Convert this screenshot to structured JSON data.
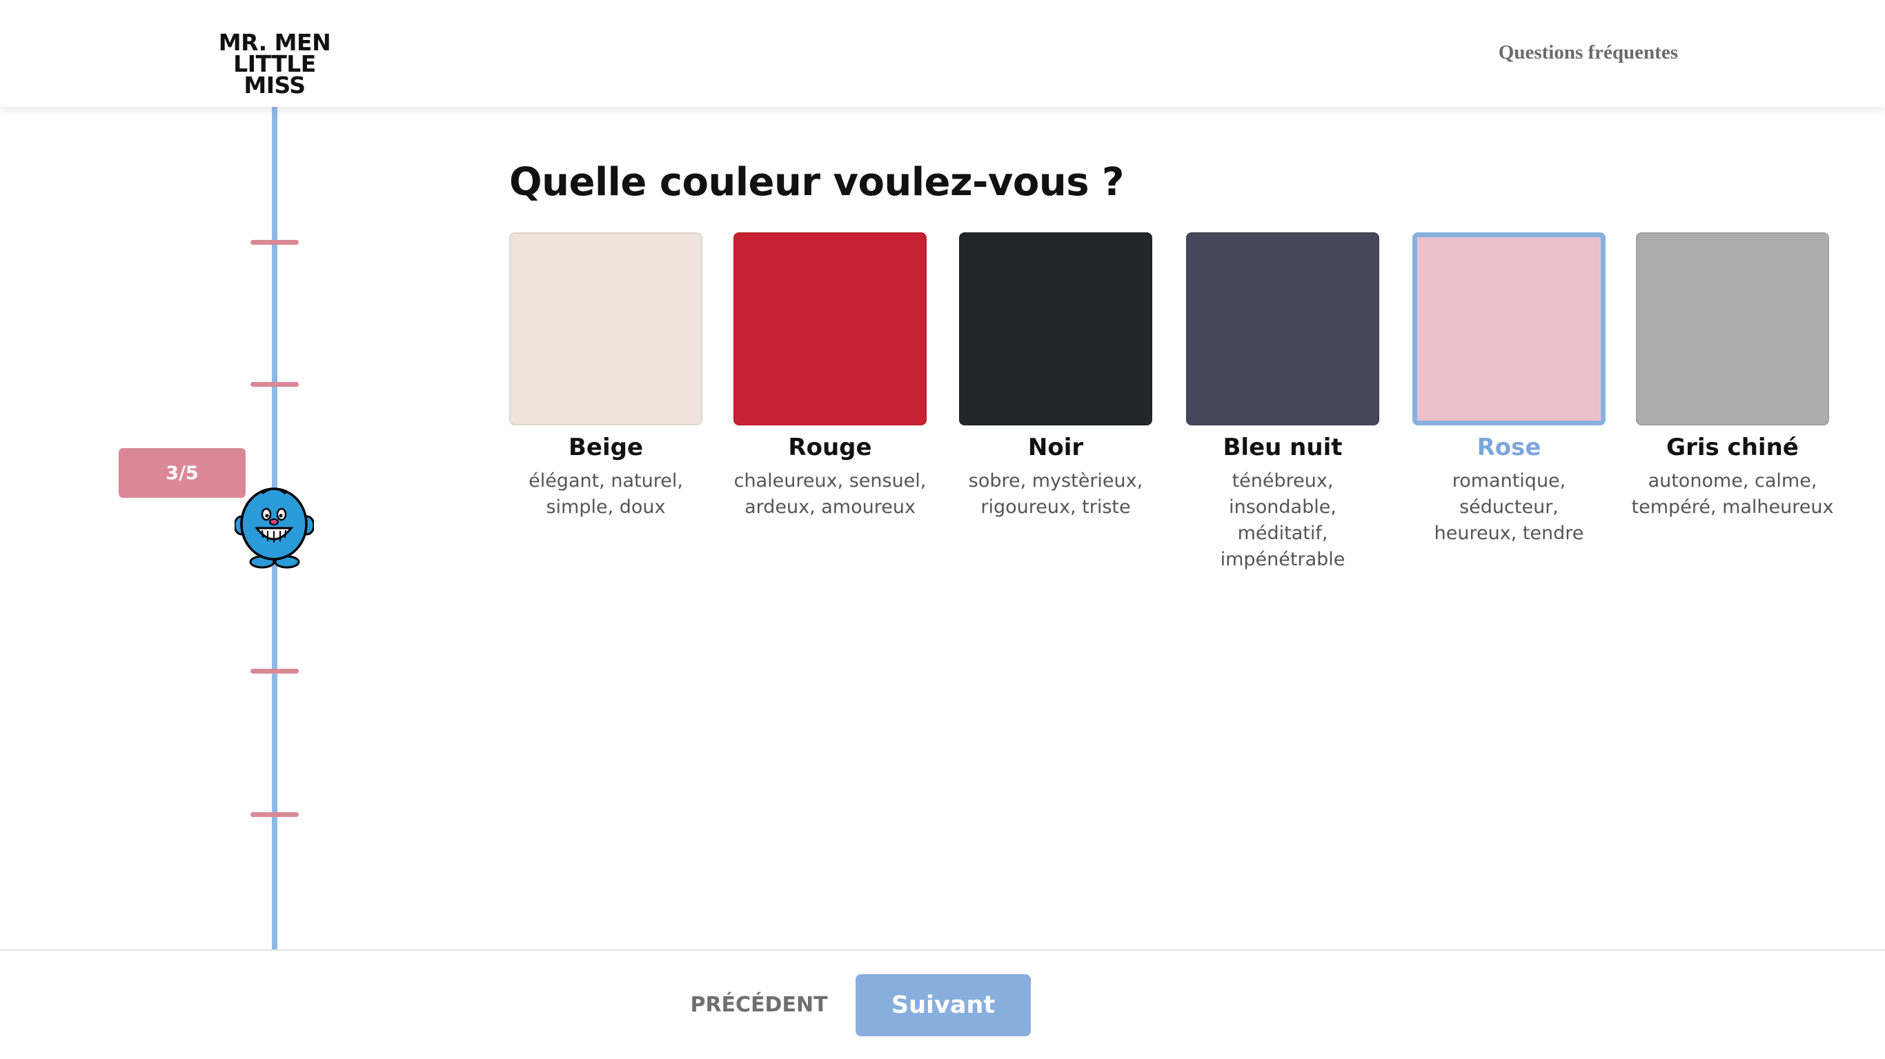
{
  "header": {
    "logo_line1": "MR. MEN",
    "logo_line2": "LITTLE MISS",
    "faq_link": "Questions fréquentes"
  },
  "progress": {
    "step_label": "3/5",
    "current_step": 3,
    "total_steps": 5
  },
  "question": {
    "title": "Quelle couleur voulez-vous ?"
  },
  "colors": [
    {
      "name": "Beige",
      "desc1": "élégant, naturel,",
      "desc2": "simple, doux",
      "hex": "#efe4da",
      "selected": false
    },
    {
      "name": "Rouge",
      "desc1": "chaleureux, sensuel,",
      "desc2": "ardeux, amoureux",
      "hex": "#c72131",
      "selected": false
    },
    {
      "name": "Noir",
      "desc1": "sobre, mystèrieux,",
      "desc2": "rigoureux, triste",
      "hex": "#212728",
      "selected": false
    },
    {
      "name": "Bleu nuit",
      "desc1": "ténébreux, insondable,",
      "desc2": "méditatif, impénétrable",
      "hex": "#45475a",
      "selected": false
    },
    {
      "name": "Rose",
      "desc1": "romantique, séducteur,",
      "desc2": "heureux, tendre",
      "hex": "#ebc0cb",
      "selected": true
    },
    {
      "name": "Gris chiné",
      "desc1": "autonome, calme,",
      "desc2": "tempéré, malheureux",
      "hex": "#acacac",
      "selected": false
    }
  ],
  "footer": {
    "prev_label": "PRÉCÉDENT",
    "next_label": "Suivant"
  },
  "theme": {
    "accent_blue": "#88aede",
    "accent_pink": "#da8896",
    "character_blue": "#2a9ad8"
  }
}
